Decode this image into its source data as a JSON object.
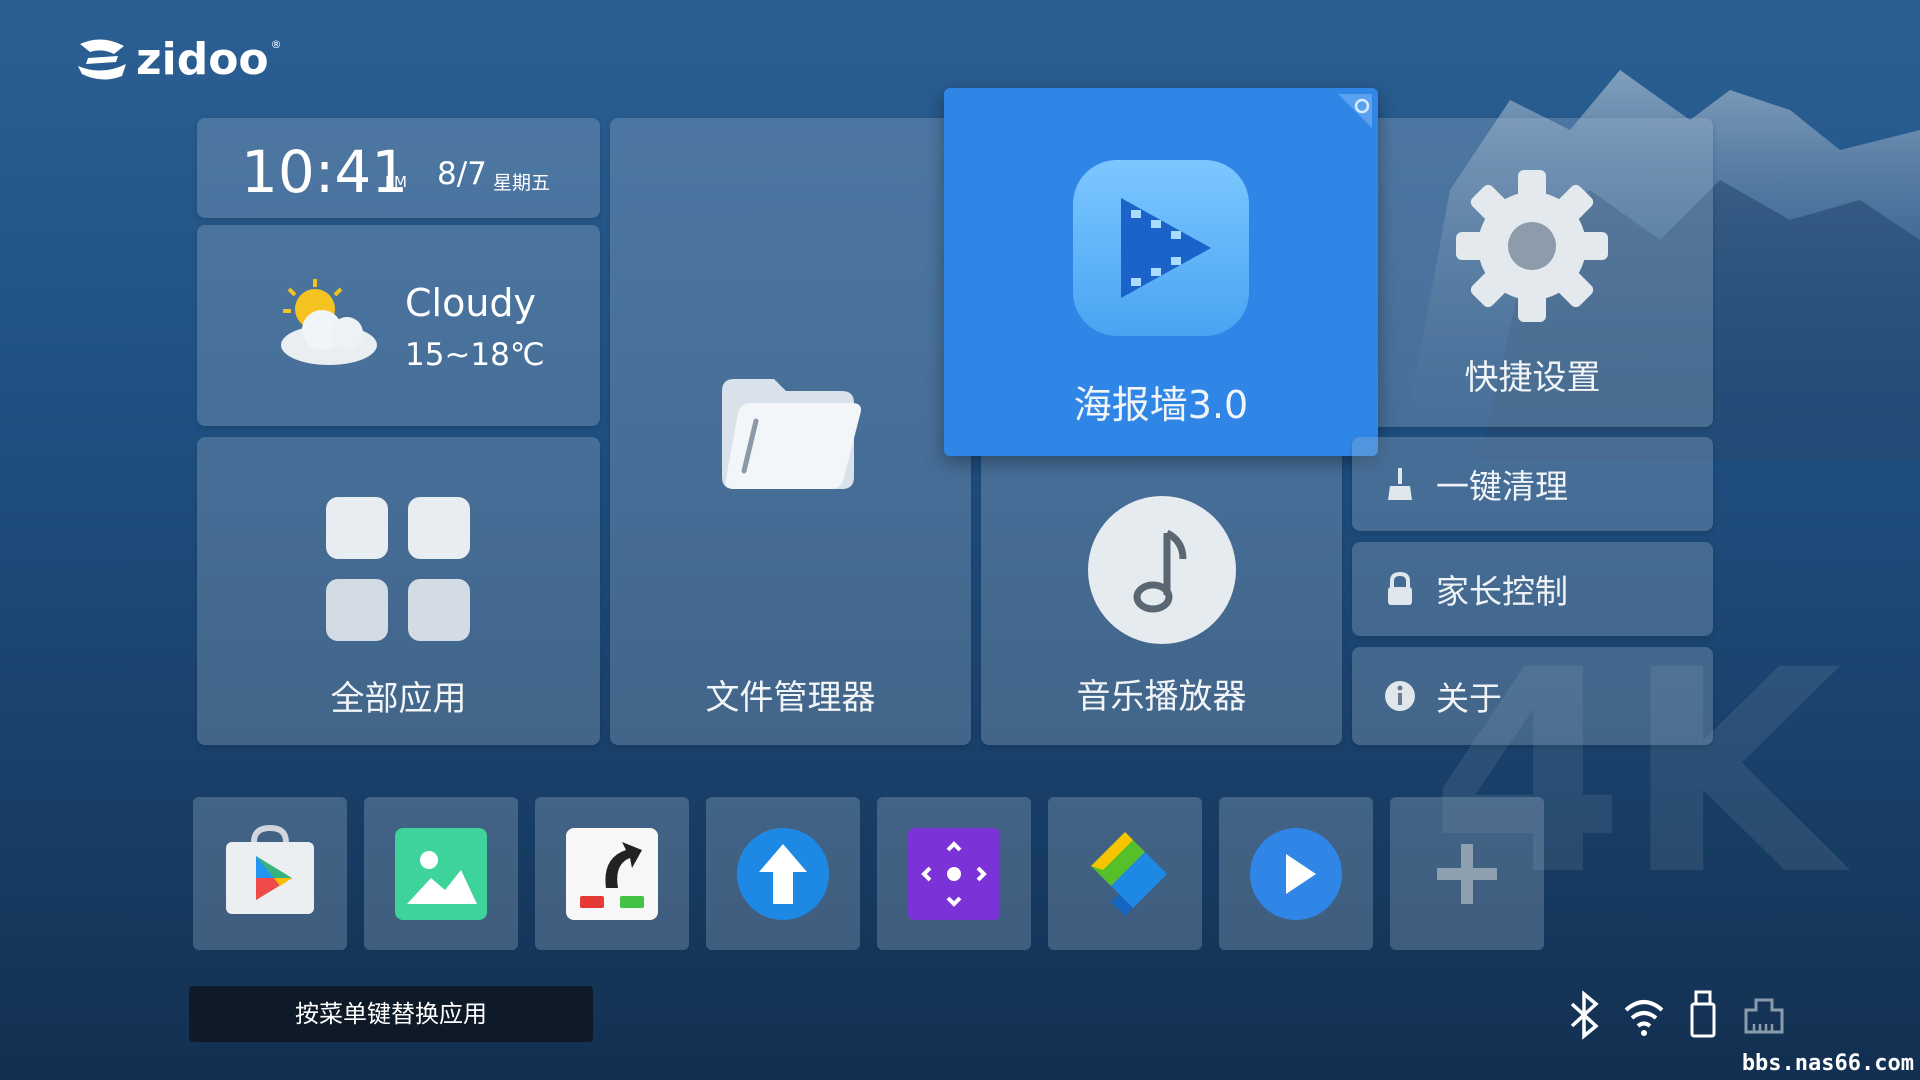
{
  "brand": {
    "logo_text": "zidoo",
    "reg_mark": "®"
  },
  "clock": {
    "time": "10:41",
    "ampm": "PM",
    "date": "8/7",
    "weekday": "星期五"
  },
  "weather": {
    "condition": "Cloudy",
    "temperature": "15~18℃",
    "icon": "partly-cloudy-icon"
  },
  "tiles": {
    "all_apps": "全部应用",
    "file_manager": "文件管理器",
    "poster_wall": "海报墙3.0",
    "music_player": "音乐播放器",
    "quick_settings": "快捷设置"
  },
  "side_menu": [
    {
      "label": "一键清理",
      "icon": "broom-icon"
    },
    {
      "label": "家长控制",
      "icon": "lock-icon"
    },
    {
      "label": "关于",
      "icon": "info-icon"
    }
  ],
  "dock": [
    {
      "app": "play-store-icon"
    },
    {
      "app": "gallery-icon"
    },
    {
      "app": "shortcut-app-icon"
    },
    {
      "app": "upload-icon"
    },
    {
      "app": "remote-control-icon"
    },
    {
      "app": "kodi-like-app-icon"
    },
    {
      "app": "video-player-icon"
    },
    {
      "app": "add-app-icon"
    }
  ],
  "hint": "按菜单键替换应用",
  "status_icons": [
    "bluetooth-icon",
    "wifi-icon",
    "usb-icon",
    "ethernet-icon"
  ],
  "watermark_site": "bbs.nas66.com",
  "colors": {
    "accent": "#2f86e6",
    "tile": "rgba(162,185,210,0.30)",
    "background_top": "#2b5f93",
    "background_bottom": "#122f50"
  }
}
